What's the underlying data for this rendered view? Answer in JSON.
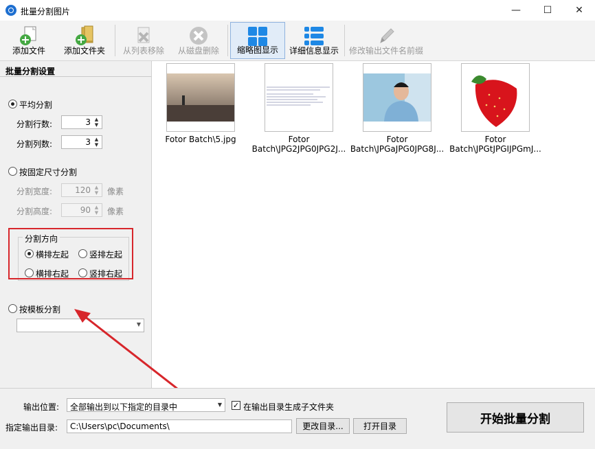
{
  "window": {
    "title": "批量分割图片"
  },
  "toolbar": {
    "items": [
      {
        "label": "添加文件",
        "icon": "add-file-icon"
      },
      {
        "label": "添加文件夹",
        "icon": "add-folder-icon"
      },
      {
        "label": "从列表移除",
        "icon": "remove-from-list-icon"
      },
      {
        "label": "从磁盘删除",
        "icon": "delete-from-disk-icon"
      },
      {
        "label": "缩略图显示",
        "icon": "thumbnail-view-icon"
      },
      {
        "label": "详细信息显示",
        "icon": "detail-view-icon"
      },
      {
        "label": "修改输出文件名前缀",
        "icon": "pencil-icon"
      }
    ]
  },
  "panel": {
    "title": "批量分割设置",
    "even_split": {
      "label": "平均分割",
      "rows_label": "分割行数:",
      "rows_value": "3",
      "cols_label": "分割列数:",
      "cols_value": "3"
    },
    "fixed_split": {
      "label": "按固定尺寸分割",
      "width_label": "分割宽度:",
      "width_value": "120",
      "height_label": "分割高度:",
      "height_value": "90",
      "unit": "像素"
    },
    "direction": {
      "title": "分割方向",
      "opt1": "横排左起",
      "opt2": "竖排左起",
      "opt3": "横排右起",
      "opt4": "竖排右起"
    },
    "template_split": {
      "label": "按模板分割",
      "selected": ""
    }
  },
  "files": [
    {
      "caption1": "Fotor Batch\\5.jpg",
      "caption2": ""
    },
    {
      "caption1": "Fotor",
      "caption2": "Batch\\JPG2JPG0JPG2J..."
    },
    {
      "caption1": "Fotor",
      "caption2": "Batch\\JPGaJPG0JPG8J..."
    },
    {
      "caption1": "Fotor",
      "caption2": "Batch\\JPGtJPGIJPGmJ..."
    }
  ],
  "bottom": {
    "output_location_label": "输出位置:",
    "output_location_value": "全部输出到以下指定的目录中",
    "subfolder_label": "在输出目录生成子文件夹",
    "output_dir_label": "指定输出目录:",
    "output_dir_value": "C:\\Users\\pc\\Documents\\",
    "change_dir_label": "更改目录...",
    "open_dir_label": "打开目录",
    "start_label": "开始批量分割"
  },
  "colors": {
    "accent": "#1e88e5",
    "highlight_box": "#d7262b"
  }
}
